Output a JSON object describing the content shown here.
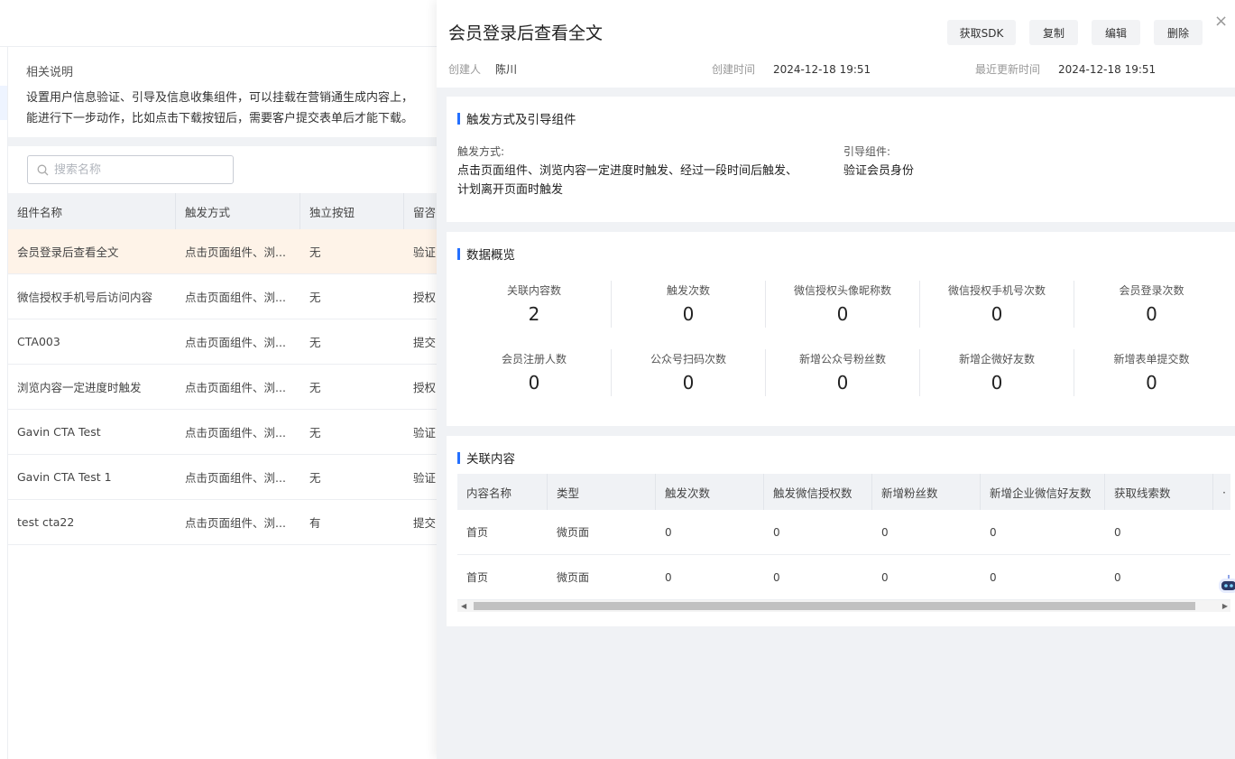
{
  "background": {
    "note": {
      "title": "相关说明",
      "line1": "设置用户信息验证、引导及信息收集组件，可以挂载在营销通生成内容上，",
      "line2": "能进行下一步动作，比如点击下载按钮后，需要客户提交表单后才能下载。"
    },
    "search": {
      "placeholder": "搜索名称"
    },
    "table": {
      "headers": [
        "组件名称",
        "触发方式",
        "独立按钮",
        "留咨"
      ],
      "rows": [
        [
          "会员登录后查看全文",
          "点击页面组件、浏...",
          "无",
          "验证"
        ],
        [
          "微信授权手机号后访问内容",
          "点击页面组件、浏...",
          "无",
          "授权"
        ],
        [
          "CTA003",
          "点击页面组件、浏...",
          "无",
          "提交"
        ],
        [
          "浏览内容一定进度时触发",
          "点击页面组件、浏...",
          "无",
          "授权"
        ],
        [
          "Gavin CTA Test",
          "点击页面组件、浏...",
          "无",
          "验证"
        ],
        [
          "Gavin CTA Test 1",
          "点击页面组件、浏...",
          "无",
          "验证"
        ],
        [
          "test cta22",
          "点击页面组件、浏...",
          "有",
          "提交"
        ]
      ]
    }
  },
  "drawer": {
    "title": "会员登录后查看全文",
    "buttons": {
      "sdk": "获取SDK",
      "copy": "复制",
      "edit": "编辑",
      "delete": "删除"
    },
    "close": "×",
    "meta": {
      "creator_label": "创建人",
      "creator": "陈川",
      "created_label": "创建时间",
      "created": "2024-12-18 19:51",
      "updated_label": "最近更新时间",
      "updated": "2024-12-18 19:51"
    },
    "trigger_card": {
      "title": "触发方式及引导组件",
      "trigger_label": "触发方式:",
      "trigger_line1": "点击页面组件、浏览内容一定进度时触发、经过一段时间后触发、",
      "trigger_line2": "计划离开页面时触发",
      "guide_label": "引导组件:",
      "guide_value": "验证会员身份"
    },
    "overview_card": {
      "title": "数据概览",
      "stats": [
        {
          "label": "关联内容数",
          "value": "2"
        },
        {
          "label": "触发次数",
          "value": "0"
        },
        {
          "label": "微信授权头像昵称数",
          "value": "0"
        },
        {
          "label": "微信授权手机号次数",
          "value": "0"
        },
        {
          "label": "会员登录次数",
          "value": "0"
        },
        {
          "label": "会员注册人数",
          "value": "0"
        },
        {
          "label": "公众号扫码次数",
          "value": "0"
        },
        {
          "label": "新增公众号粉丝数",
          "value": "0"
        },
        {
          "label": "新增企微好友数",
          "value": "0"
        },
        {
          "label": "新增表单提交数",
          "value": "0"
        }
      ]
    },
    "content_card": {
      "title": "关联内容",
      "headers": [
        "内容名称",
        "类型",
        "触发次数",
        "触发微信授权数",
        "新增粉丝数",
        "新增企业微信好友数",
        "获取线索数",
        "·"
      ],
      "rows": [
        [
          "首页",
          "微页面",
          "0",
          "0",
          "0",
          "0",
          "0"
        ],
        [
          "首页",
          "微页面",
          "0",
          "0",
          "0",
          "0",
          "0"
        ]
      ],
      "scroll_left": "◀",
      "scroll_right": "▶"
    }
  },
  "colors": {
    "accent": "#2470ff",
    "active_row": "#fef3e8",
    "drawer_bg": "#f0f2f5"
  },
  "icons": [
    "search-icon",
    "close-icon",
    "robot-assistant-icon"
  ]
}
